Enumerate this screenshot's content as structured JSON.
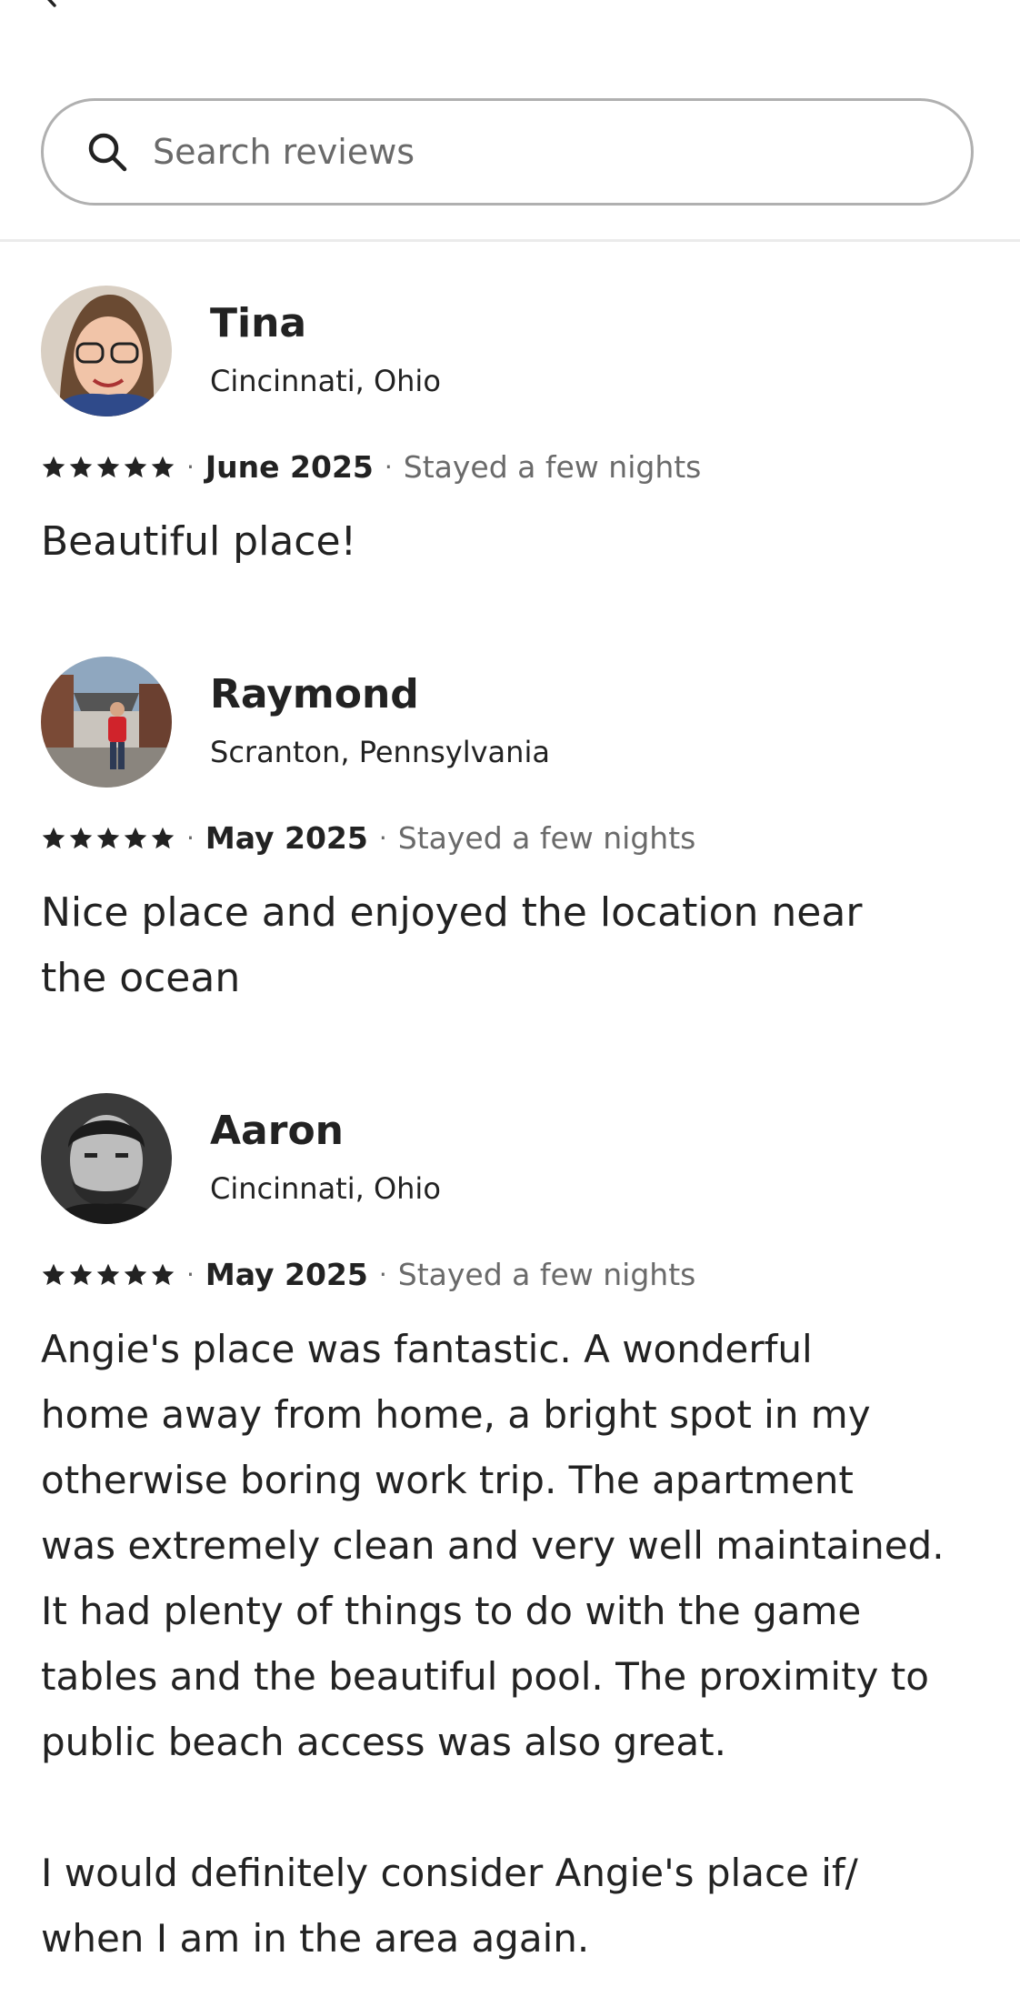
{
  "search": {
    "placeholder": "Search reviews"
  },
  "reviews": [
    {
      "name": "Tina",
      "location": "Cincinnati, Ohio",
      "rating": 5,
      "date": "June 2025",
      "stay": "Stayed a few nights",
      "text": "Beautiful place!"
    },
    {
      "name": "Raymond",
      "location": "Scranton, Pennsylvania",
      "rating": 5,
      "date": "May 2025",
      "stay": "Stayed a few nights",
      "text": "Nice place and enjoyed the location near\nthe ocean"
    },
    {
      "name": "Aaron",
      "location": "Cincinnati, Ohio",
      "rating": 5,
      "date": "May 2025",
      "stay": "Stayed a few nights",
      "text": "Angie's place was fantastic. A wonderful\nhome away from home, a bright spot in my\notherwise boring work trip. The apartment\nwas extremely clean and very well maintained.\nIt had plenty of things to do with the game\ntables and the beautiful pool. The proximity to\npublic beach access was also great.\n\nI would definitely consider Angie's place if/\nwhen I am in the area again."
    }
  ],
  "separator": "·",
  "icons": {
    "back": "chevron-left-icon",
    "search": "search-icon",
    "star": "star-icon"
  },
  "colors": {
    "text": "#222222",
    "muted": "#6a6a6a",
    "border": "#b0b0b0",
    "divider": "#ebebeb"
  }
}
